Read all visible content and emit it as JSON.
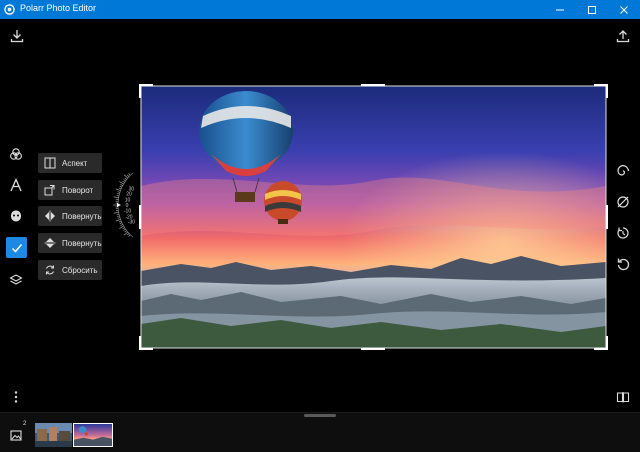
{
  "window": {
    "title": "Polarr Photo Editor"
  },
  "left_tools": [
    {
      "name": "filters-tool",
      "icon": "three-circles-icon"
    },
    {
      "name": "text-tool",
      "icon": "letter-a-icon"
    },
    {
      "name": "face-tool",
      "icon": "face-icon"
    },
    {
      "name": "crop-tool",
      "icon": "checkmark-icon",
      "active": true
    },
    {
      "name": "layers-tool",
      "icon": "layers-icon"
    }
  ],
  "crop_menu": {
    "aspect": "Аспект",
    "rotate": "Поворот",
    "flip_horizontal": "Повернуть",
    "flip_vertical": "Повернуть",
    "reset": "Сбросить"
  },
  "rotation_dial": {
    "ticks": [
      "-30",
      "-20",
      "-10",
      "0",
      "10",
      "20",
      "30"
    ],
    "value": 0
  },
  "right_tools": [
    {
      "name": "spiral-tool",
      "icon": "spiral-icon"
    },
    {
      "name": "no-guide-tool",
      "icon": "circle-slash-icon"
    },
    {
      "name": "timer-tool",
      "icon": "timer-icon"
    },
    {
      "name": "undo-tool",
      "icon": "rotate-left-icon"
    }
  ],
  "filmstrip": {
    "image_count_badge": "2",
    "selected_index": 1
  },
  "colors": {
    "titlebar": "#0078d7",
    "accent": "#1e88e5",
    "panel": "#2a2a2a",
    "background": "#000000"
  }
}
